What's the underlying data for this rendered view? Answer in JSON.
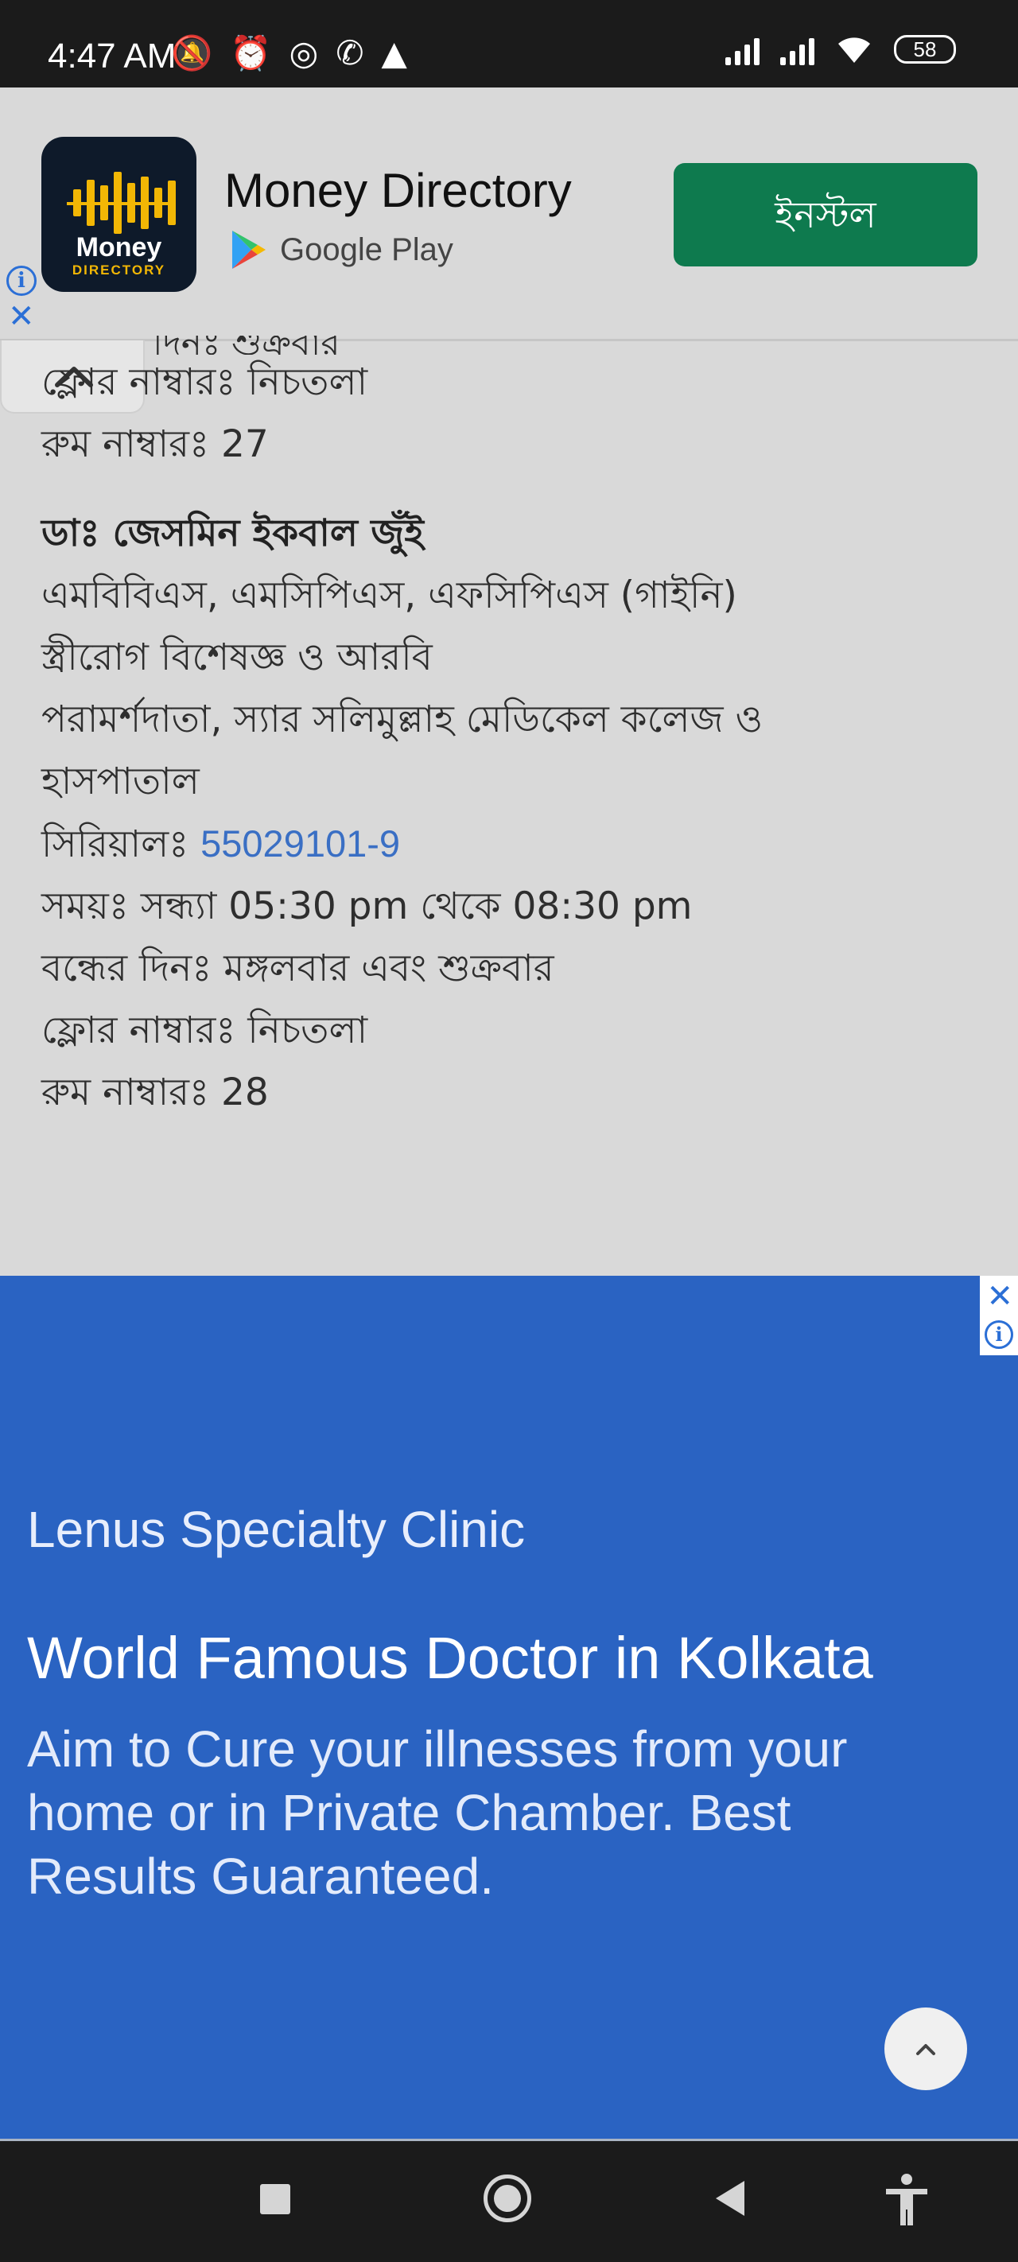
{
  "status_bar": {
    "time": "4:47 AM",
    "battery": "58"
  },
  "top_ad": {
    "app_name": "Money Directory",
    "logo_word": "Money",
    "logo_sub": "DIRECTORY",
    "store": "Google Play",
    "install_label": "ইনস্টল",
    "info_icon": "info-icon",
    "close_icon": "close-icon"
  },
  "content": {
    "cut_text": "দিনঃ শুক্রবার",
    "prev_entry": {
      "floor": "ফ্লোর নাম্বারঃ নিচতলা",
      "room": "রুম নাম্বারঃ 27"
    },
    "doctor": {
      "name": "ডাঃ জেসমিন ইকবাল জুঁই",
      "degrees": "এমবিবিএস, এমসিপিএস, এফসিপিএস (গাইনি)",
      "specialty": "স্ত্রীরোগ বিশেষজ্ঞ ও আরবি",
      "position_line1": "পরামর্শদাতা, স্যার সলিমুল্লাহ মেডিকেল কলেজ ও",
      "position_line2": "হাসপাতাল",
      "serial_label": "সিরিয়ালঃ ",
      "serial_number": "55029101-9",
      "time": "সময়ঃ সন্ধ্যা 05:30 pm থেকে 08:30 pm",
      "closed_days": "বন্ধের দিনঃ মঙ্গলবার এবং শুক্রবার",
      "floor": "ফ্লোর নাম্বারঃ নিচতলা",
      "room": "রুম নাম্বারঃ 28"
    }
  },
  "bottom_ad": {
    "brand": "Lenus Specialty Clinic",
    "headline": "World Famous Doctor in Kolkata",
    "description": "Aim to Cure your illnesses from your home or in Private Chamber. Best Results Guaranteed."
  },
  "colors": {
    "install_button": "#0e7a4e",
    "ad_background": "#2a63c2",
    "link": "#3a6fc4"
  }
}
